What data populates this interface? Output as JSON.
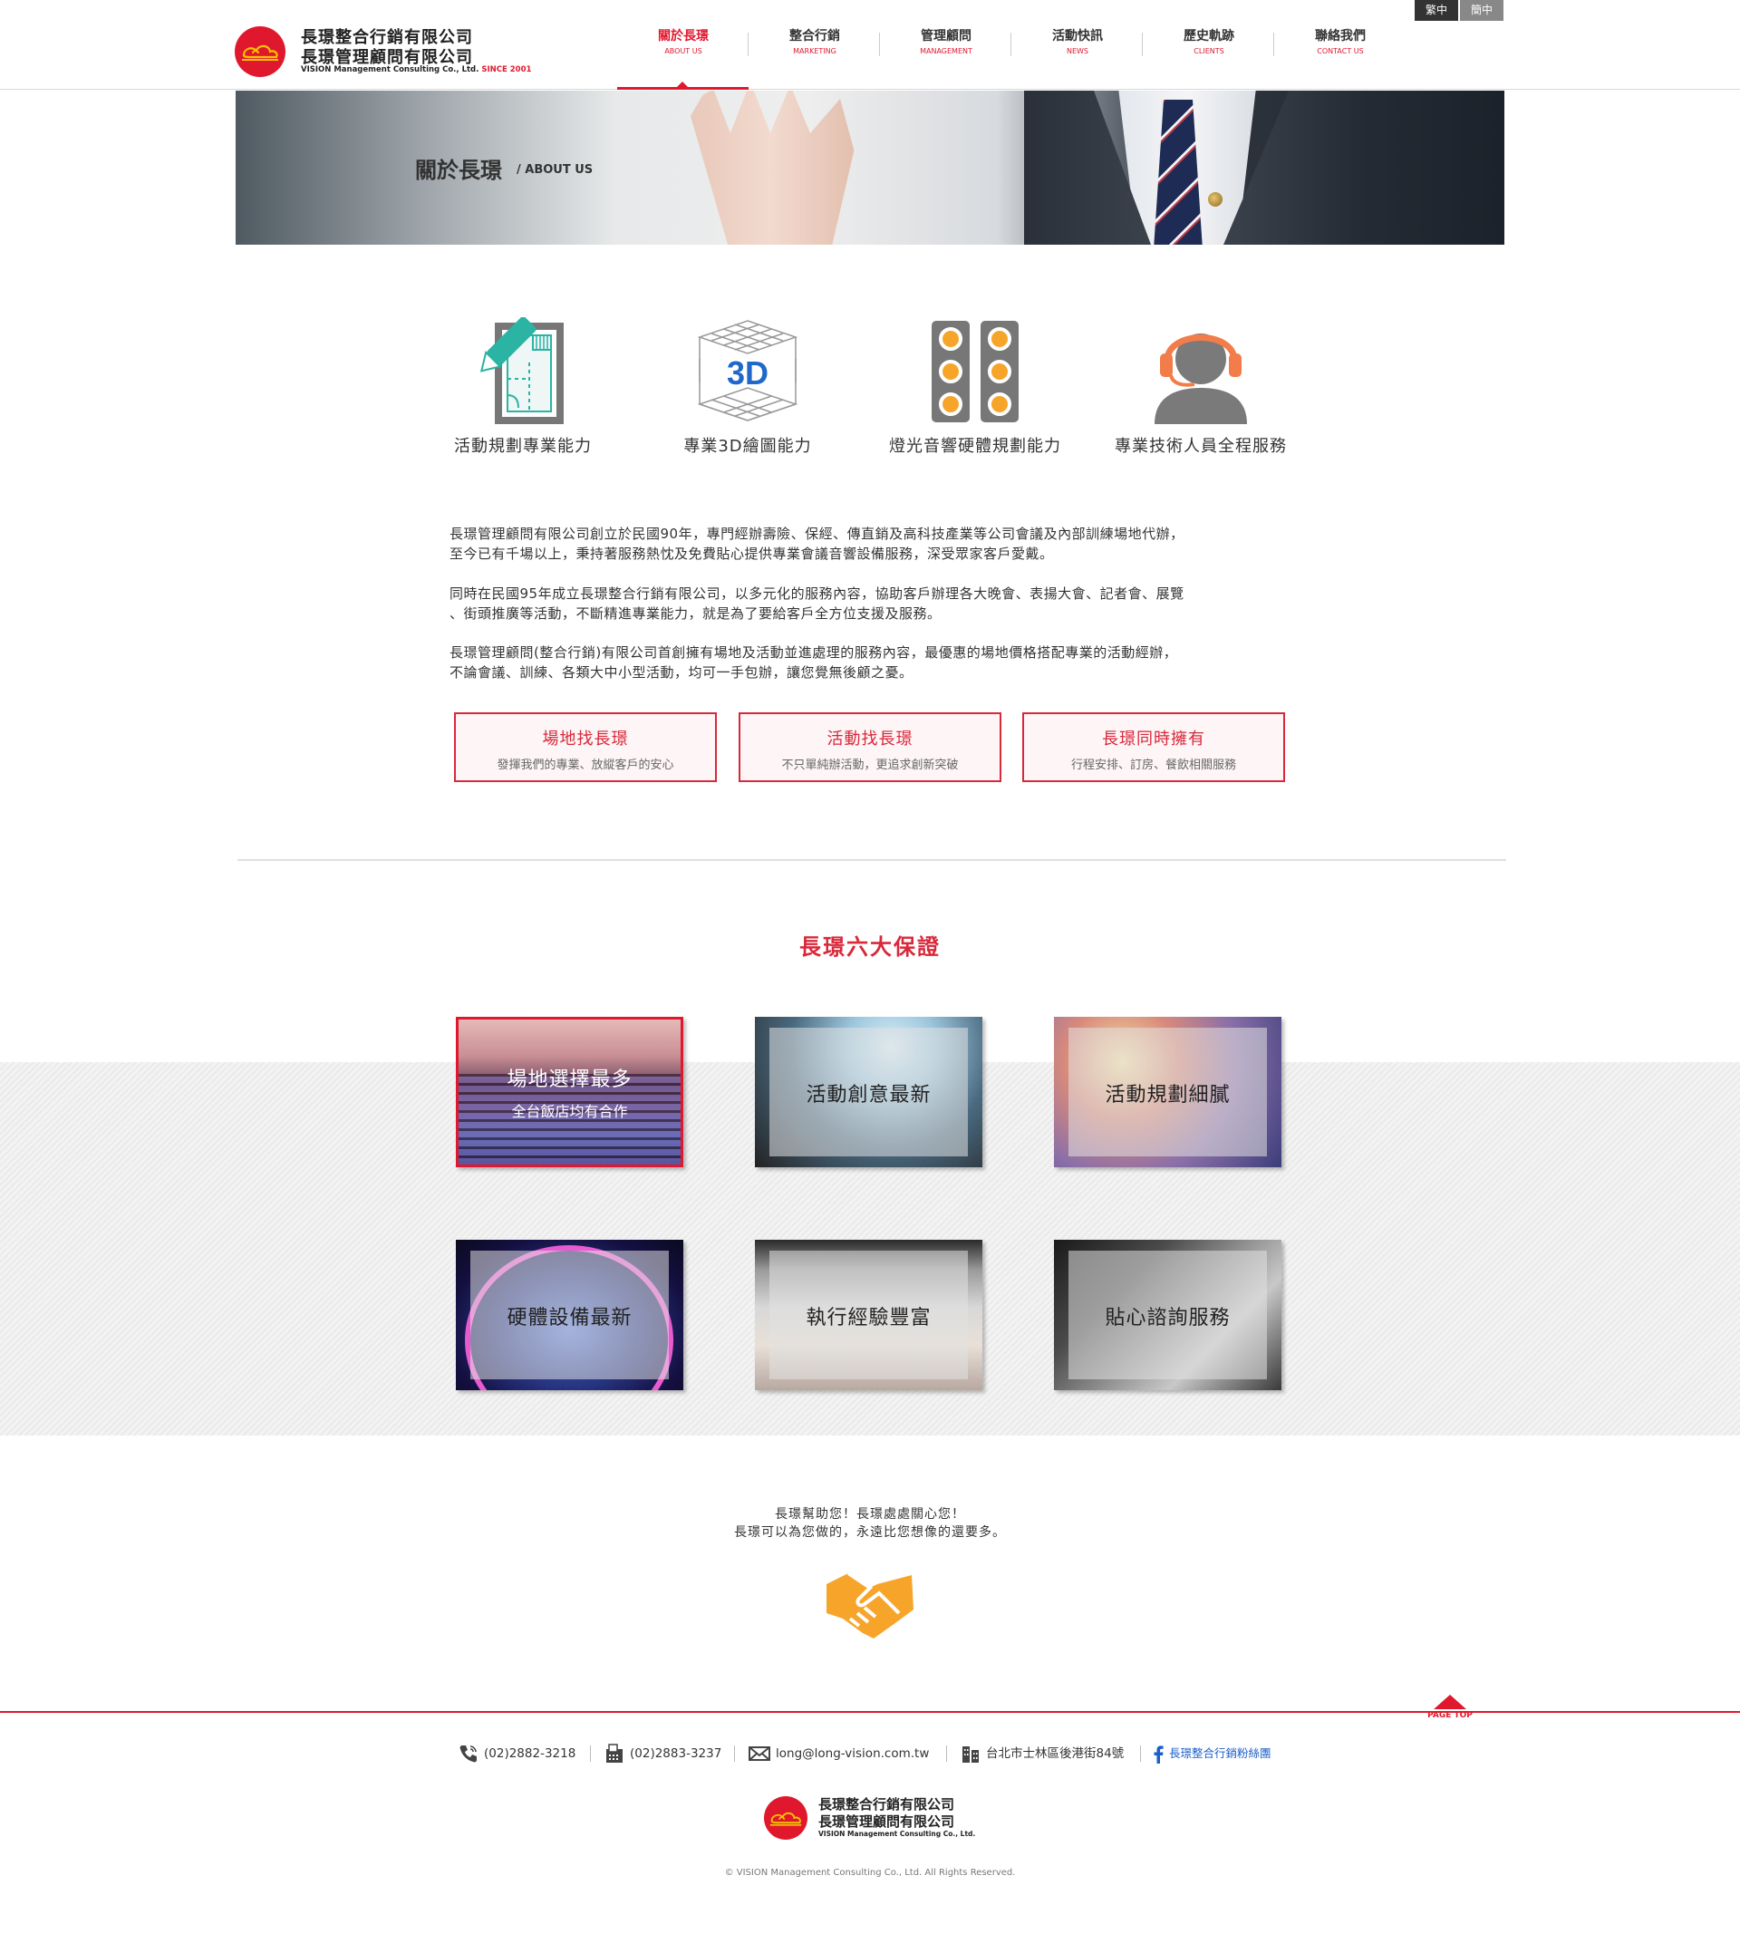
{
  "header": {
    "logo": {
      "line1": "長璟整合行銷有限公司",
      "line2": "長璟管理顧問有限公司",
      "line3": "VISION Management Consulting Co., Ltd.",
      "since": "SINCE 2001"
    },
    "lang": {
      "tw": "繁中",
      "cn": "簡中"
    },
    "nav": [
      {
        "zh": "關於長璟",
        "en": "ABOUT US",
        "active": true
      },
      {
        "zh": "整合行銷",
        "en": "MARKETING"
      },
      {
        "zh": "管理顧問",
        "en": "MANAGEMENT"
      },
      {
        "zh": "活動快訊",
        "en": "NEWS"
      },
      {
        "zh": "歷史軌跡",
        "en": "CLIENTS"
      },
      {
        "zh": "聯絡我們",
        "en": "CONTACT US"
      }
    ]
  },
  "banner": {
    "title": "關於長璟",
    "subtitle": "/ ABOUT US"
  },
  "features": [
    {
      "label": "活動規劃專業能力",
      "icon": "floorplan-icon"
    },
    {
      "label": "專業3D繪圖能力",
      "icon": "3d-cube-icon"
    },
    {
      "label": "燈光音響硬體規劃能力",
      "icon": "speaker-icon"
    },
    {
      "label": "專業技術人員全程服務",
      "icon": "headset-person-icon"
    }
  ],
  "paragraphs": [
    {
      "l1": "長璟管理顧問有限公司創立於民國90年，專門經辦壽險、保經、傳直銷及高科技產業等公司會議及內部訓練場地代辦，",
      "l2": "至今已有千場以上，秉持著服務熱忱及免費貼心提供專業會議音響設備服務，深受眾家客戶愛戴。"
    },
    {
      "l1": "同時在民國95年成立長璟整合行銷有限公司，以多元化的服務內容，協助客戶辦理各大晚會、表揚大會、記者會、展覽",
      "l2": "、街頭推廣等活動，不斷精進專業能力，就是為了要給客戶全方位支援及服務。"
    },
    {
      "l1": "長璟管理顧問(整合行銷)有限公司首創擁有場地及活動並進處理的服務內容，最優惠的場地價格搭配專業的活動經辦，",
      "l2": "不論會議、訓練、各類大中小型活動，均可一手包辦，讓您覺無後顧之憂。"
    }
  ],
  "buttons": [
    {
      "title": "場地找長璟",
      "sub": "發揮我們的專業、放縱客戶的安心"
    },
    {
      "title": "活動找長璟",
      "sub": "不只單純辦活動，更追求創新突破"
    },
    {
      "title": "長璟同時擁有",
      "sub": "行程安排、訂房、餐飲相關服務"
    }
  ],
  "guarantee": {
    "title": "長璟六大保證",
    "cards": [
      {
        "title": "場地選擇最多",
        "sub": "全台飯店均有合作",
        "selected": true
      },
      {
        "title": "活動創意最新"
      },
      {
        "title": "活動規劃細膩"
      },
      {
        "title": "硬體設備最新"
      },
      {
        "title": "執行經驗豐富"
      },
      {
        "title": "貼心諮詢服務"
      }
    ]
  },
  "slogan": {
    "line1": "長璟幫助您！長璟處處關心您！",
    "line2": "長璟可以為您做的，永遠比您想像的還要多。"
  },
  "footer": {
    "page_top": "PAGE TOP",
    "phone": "(02)2882-3218",
    "fax": "(02)2883-3237",
    "email": "long@long-vision.com.tw",
    "address": "台北市士林區後港街84號",
    "facebook": "長璟整合行銷粉絲團",
    "copyright": "© VISION Management Consulting Co., Ltd. All Rights Reserved."
  },
  "colors": {
    "brand_red": "#e0182d",
    "accent_orange": "#f7a52a",
    "teal": "#2bb3a3"
  }
}
